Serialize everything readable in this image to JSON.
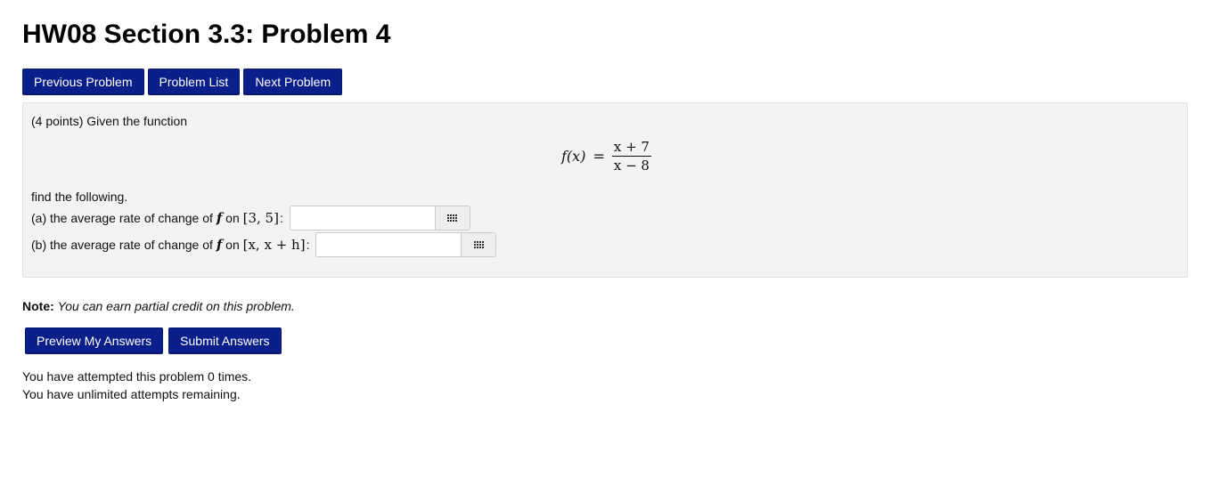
{
  "title": "HW08 Section 3.3: Problem 4",
  "nav": {
    "previous": "Previous Problem",
    "list": "Problem List",
    "next": "Next Problem"
  },
  "problem": {
    "intro": "(4 points) Given the function",
    "formula": {
      "lhs": "f(x)",
      "equals": "=",
      "numerator": "x + 7",
      "denominator": "x − 8"
    },
    "find": "find the following.",
    "parts": [
      {
        "label_prefix": "(a) the average rate of change of",
        "func": "f",
        "on": "on",
        "interval": "[3, 5]",
        "colon": ":",
        "value": "",
        "icon": "grid-icon"
      },
      {
        "label_prefix": "(b) the average rate of change of",
        "func": "f",
        "on": "on",
        "interval": "[x, x + h]",
        "colon": ":",
        "value": "",
        "icon": "grid-icon"
      }
    ]
  },
  "note": {
    "label": "Note:",
    "text": "You can earn partial credit on this problem."
  },
  "actions": {
    "preview": "Preview My Answers",
    "submit": "Submit Answers"
  },
  "attempts": {
    "line1": "You have attempted this problem 0 times.",
    "line2": "You have unlimited attempts remaining."
  },
  "colors": {
    "button_bg": "#0b1f8a",
    "panel_bg": "#f3f3f3"
  }
}
